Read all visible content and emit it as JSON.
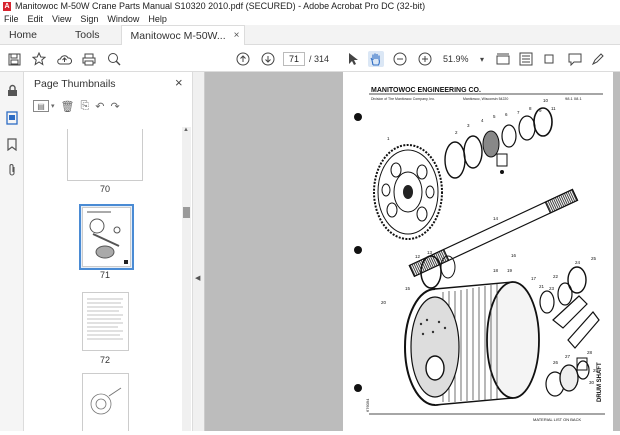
{
  "window": {
    "title": "Manitowoc M-50W Crane Parts Manual S10320 2010.pdf (SECURED) - Adobe Acrobat Pro DC (32-bit)",
    "app_icon": "A"
  },
  "menu": [
    "File",
    "Edit",
    "View",
    "Sign",
    "Window",
    "Help"
  ],
  "tabs": {
    "home": "Home",
    "tools": "Tools",
    "document": "Manitowoc M-50W...",
    "close": "×"
  },
  "toolbar": {
    "page_current": "71",
    "page_total": "/ 314",
    "zoom": "51.9%"
  },
  "panel": {
    "title": "Page Thumbnails",
    "close": "×",
    "thumbnails": [
      {
        "label": "70"
      },
      {
        "label": "71"
      },
      {
        "label": "72"
      }
    ]
  },
  "document_page": {
    "header": "MANITOWOC ENGINEERING CO.",
    "subheader": "Division of The Manitowoc Company, Inc.",
    "location": "Manitowoc, Wisconsin 54220",
    "page_ref": "98.1   08.1",
    "side_title": "DRUM SHAFT",
    "footer": "MATERIAL LIST ON BACK",
    "part_code": "676094",
    "part_numbers": [
      "1",
      "2",
      "3",
      "4",
      "5",
      "6",
      "7",
      "8",
      "9",
      "10",
      "11",
      "12",
      "13",
      "14",
      "15",
      "16",
      "17",
      "18",
      "19",
      "20",
      "21",
      "22",
      "23",
      "24",
      "25",
      "26",
      "27",
      "28",
      "29",
      "30"
    ]
  },
  "icons": {
    "save": "save-icon",
    "star": "star-icon",
    "upload": "upload-icon",
    "print": "print-icon",
    "search": "search-icon",
    "prev": "prev-page-icon",
    "next": "next-page-icon",
    "select": "cursor-icon",
    "hand": "hand-icon",
    "zoom_out": "zoom-out-icon",
    "zoom_in": "zoom-in-icon"
  }
}
